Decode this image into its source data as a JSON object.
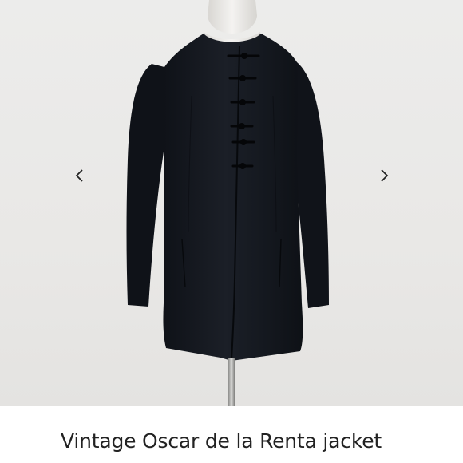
{
  "product": {
    "title": "Vintage Oscar de la Renta jacket"
  },
  "gallery": {
    "prev_icon": "chevron-left-icon",
    "next_icon": "chevron-right-icon"
  },
  "colors": {
    "background": "#ffffff",
    "photo_backdrop": "#e9e8e6",
    "garment": "#14171d",
    "text": "#222222"
  }
}
